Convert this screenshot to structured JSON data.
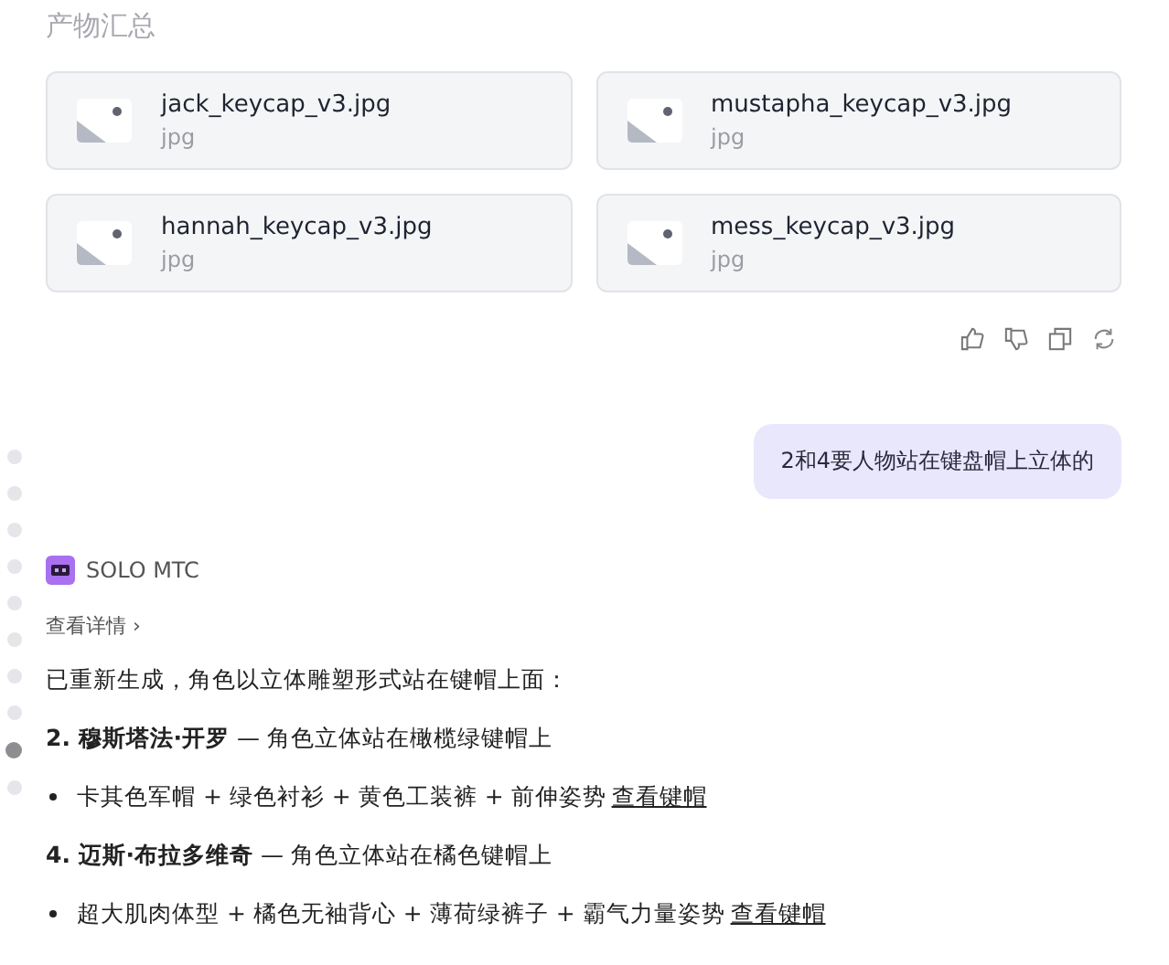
{
  "section_title": "产物汇总",
  "files": [
    {
      "name": "jack_keycap_v3.jpg",
      "type": "jpg"
    },
    {
      "name": "mustapha_keycap_v3.jpg",
      "type": "jpg"
    },
    {
      "name": "hannah_keycap_v3.jpg",
      "type": "jpg"
    },
    {
      "name": "mess_keycap_v3.jpg",
      "type": "jpg"
    }
  ],
  "actions": [
    {
      "kind": "like"
    },
    {
      "kind": "dislike"
    },
    {
      "kind": "copy"
    },
    {
      "kind": "regenerate"
    }
  ],
  "user_message": "2和4要人物站在键盘帽上立体的",
  "agent": {
    "name": "SOLO MTC",
    "details_link": "查看详情 ›"
  },
  "reply": [
    {
      "kind": "para",
      "text": "已重新生成，角色以立体雕塑形式站在键帽上面："
    },
    {
      "kind": "heading",
      "text": "**2. 穆斯塔法·开罗** — 角色立体站在橄榄绿键帽上"
    },
    {
      "kind": "bullet",
      "text": "卡其色军帽 + 绿色衬衫 + 黄色工装裤 + 前伸姿势",
      "link": "查看键帽"
    },
    {
      "kind": "heading",
      "text": "**4. 迈斯·布拉多维奇** — 角色立体站在橘色键帽上"
    },
    {
      "kind": "bullet",
      "text": "超大肌肉体型 + 橘色无袖背心 + 薄荷绿裤子 + 霸气力量姿势",
      "link": "查看键帽"
    }
  ],
  "nav_dots": [
    {
      "selected": false
    },
    {
      "selected": false
    },
    {
      "selected": false
    },
    {
      "selected": false
    },
    {
      "selected": false
    },
    {
      "selected": false
    },
    {
      "selected": false
    },
    {
      "selected": false
    },
    {
      "selected": true
    },
    {
      "selected": false
    }
  ]
}
